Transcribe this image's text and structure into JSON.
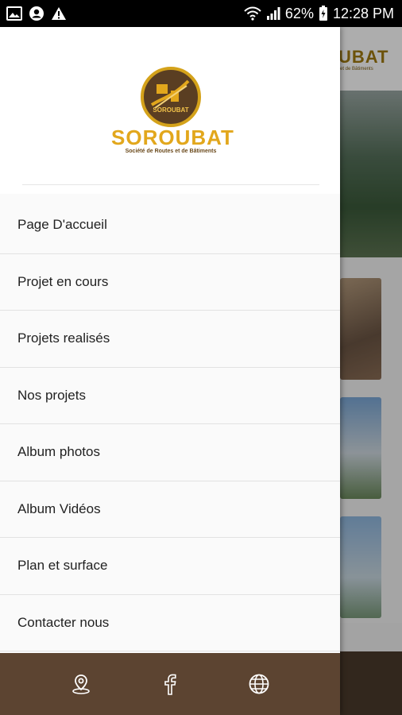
{
  "status_bar": {
    "battery": "62%",
    "time": "12:28 PM",
    "icons_left": [
      "image-icon",
      "account-circle-icon",
      "warning-icon"
    ],
    "icons_right": [
      "wifi-icon",
      "signal-icon",
      "battery-icon"
    ]
  },
  "drawer": {
    "logo": {
      "brand": "SOROUBAT",
      "inner_text": "SOROUBAT",
      "tagline": "Société de Routes et de Bâtiments"
    },
    "menu": [
      {
        "label": "Page D'accueil"
      },
      {
        "label": "Projet en cours"
      },
      {
        "label": "Projets realisés"
      },
      {
        "label": "Nos projets"
      },
      {
        "label": "Album photos"
      },
      {
        "label": "Album Vidéos"
      },
      {
        "label": "Plan et surface"
      },
      {
        "label": "Contacter nous"
      }
    ],
    "footer_icons": [
      "location-pin-icon",
      "facebook-icon",
      "globe-icon"
    ]
  },
  "background_app": {
    "brand_fragment": "UBAT",
    "tagline_fragment": "et de Bâtiments"
  },
  "colors": {
    "gold": "#e2a71c",
    "brown": "#5c4431",
    "status_bar": "#000000"
  }
}
